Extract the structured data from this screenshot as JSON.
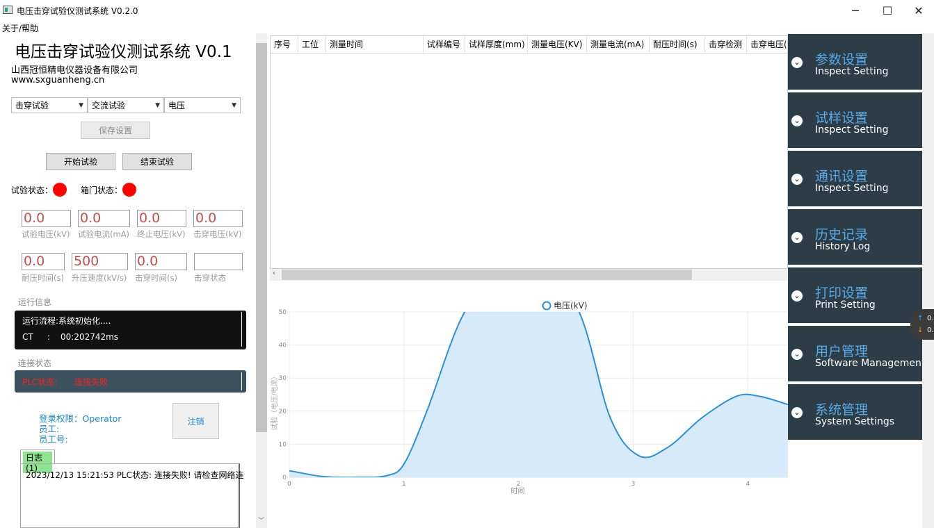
{
  "window": {
    "title": "电压击穿试验仪测试系统 V0.2.0",
    "minimize_glyph": "─",
    "maximize_glyph": "☐",
    "close_glyph": "✕"
  },
  "menu": {
    "about": "关于/帮助"
  },
  "header": {
    "title": "电压击穿试验仪测试系统 V0.1",
    "company": "山西冠恒精电仪器设备有限公司",
    "website": "www.sxguanheng.cn"
  },
  "selectors": [
    {
      "value": "击穿试验"
    },
    {
      "value": "交流试验"
    },
    {
      "value": "电压"
    }
  ],
  "buttons": {
    "save_settings": "保存设置",
    "start_test": "开始试验",
    "end_test": "结束试验",
    "logout": "注销"
  },
  "status": {
    "test_label": "试验状态：",
    "door_label": "箱门状态：",
    "test_color": "#ff0000",
    "door_color": "#ff0000"
  },
  "readings_row1": [
    {
      "value": "0.0",
      "label": "试验电压(kV)"
    },
    {
      "value": "0.0",
      "label": "试验电流(mA)"
    },
    {
      "value": "0.0",
      "label": "终止电压(kV)"
    },
    {
      "value": "0.0",
      "label": "击穿电压(kV)"
    }
  ],
  "readings_row2": [
    {
      "value": "0.0",
      "label": "耐压时间(s)"
    },
    {
      "value": "500",
      "label": "升压速度(kV/s)"
    },
    {
      "value": "0.0",
      "label": "击穿时间(s)"
    },
    {
      "value": "",
      "label": "击穿状态"
    }
  ],
  "run_info": {
    "label": "运行信息",
    "flow": "运行流程:系统初始化....",
    "ct_label": "CT",
    "ct_sep": ":",
    "ct_value": "00:202742ms"
  },
  "connection": {
    "label": "连接状态",
    "plc_label": "PLC状态:",
    "plc_value": "连接失败"
  },
  "user": {
    "role_label": "登录权限：",
    "role_value": "Operator",
    "employee_label": "员工:",
    "employee_id_label": "员工号:"
  },
  "log": {
    "tab": "日志(1)",
    "entries": [
      "2023/12/13 15:21:53  PLC状态: 连接失败! 请检查网络连"
    ]
  },
  "table": {
    "columns": [
      "序号",
      "工位",
      "测量时间",
      "试样编号",
      "试样厚度(mm)",
      "测量电压(KV)",
      "测量电流(mA)",
      "耐压时间(s)",
      "击穿检测",
      "击穿电压("
    ]
  },
  "chart_data": {
    "type": "area",
    "legend": [
      "电压(kV)"
    ],
    "legend_position": "top-center",
    "xlabel": "时间",
    "ylabel": "试验（电压/电流）",
    "xlim": [
      0,
      4.35
    ],
    "ylim": [
      0,
      50
    ],
    "xticks": [
      0,
      1,
      2,
      3,
      4
    ],
    "yticks": [
      0,
      10,
      20,
      30,
      40,
      50
    ],
    "series": [
      {
        "name": "电压(kV)",
        "color": "#2b8fd9",
        "fill": "#d7eaf9",
        "x": [
          0,
          0.3,
          0.6,
          0.85,
          1.0,
          1.2,
          1.5,
          1.8,
          2.05,
          2.5,
          2.8,
          3.05,
          3.3,
          3.6,
          3.9,
          4.1,
          4.35
        ],
        "y": [
          2,
          0.2,
          0,
          0.5,
          4,
          20,
          48,
          62,
          64,
          52,
          18,
          6.5,
          9,
          18,
          24.5,
          24.5,
          22
        ]
      }
    ],
    "grid": true
  },
  "nav": [
    {
      "zh": "参数设置",
      "en": "Inspect Setting"
    },
    {
      "zh": "试样设置",
      "en": "Inspect Setting"
    },
    {
      "zh": "通讯设置",
      "en": "Inspect Setting"
    },
    {
      "zh": "历史记录",
      "en": "History Log"
    },
    {
      "zh": "打印设置",
      "en": "Print Setting"
    },
    {
      "zh": "用户管理",
      "en": "Software Management"
    },
    {
      "zh": "系统管理",
      "en": "System Settings"
    }
  ],
  "speed_widget": {
    "up": "0.",
    "down": "0."
  },
  "icons": {
    "nav_chevron": "chevron-down-icon",
    "dropdown": "chevron-down-icon"
  }
}
